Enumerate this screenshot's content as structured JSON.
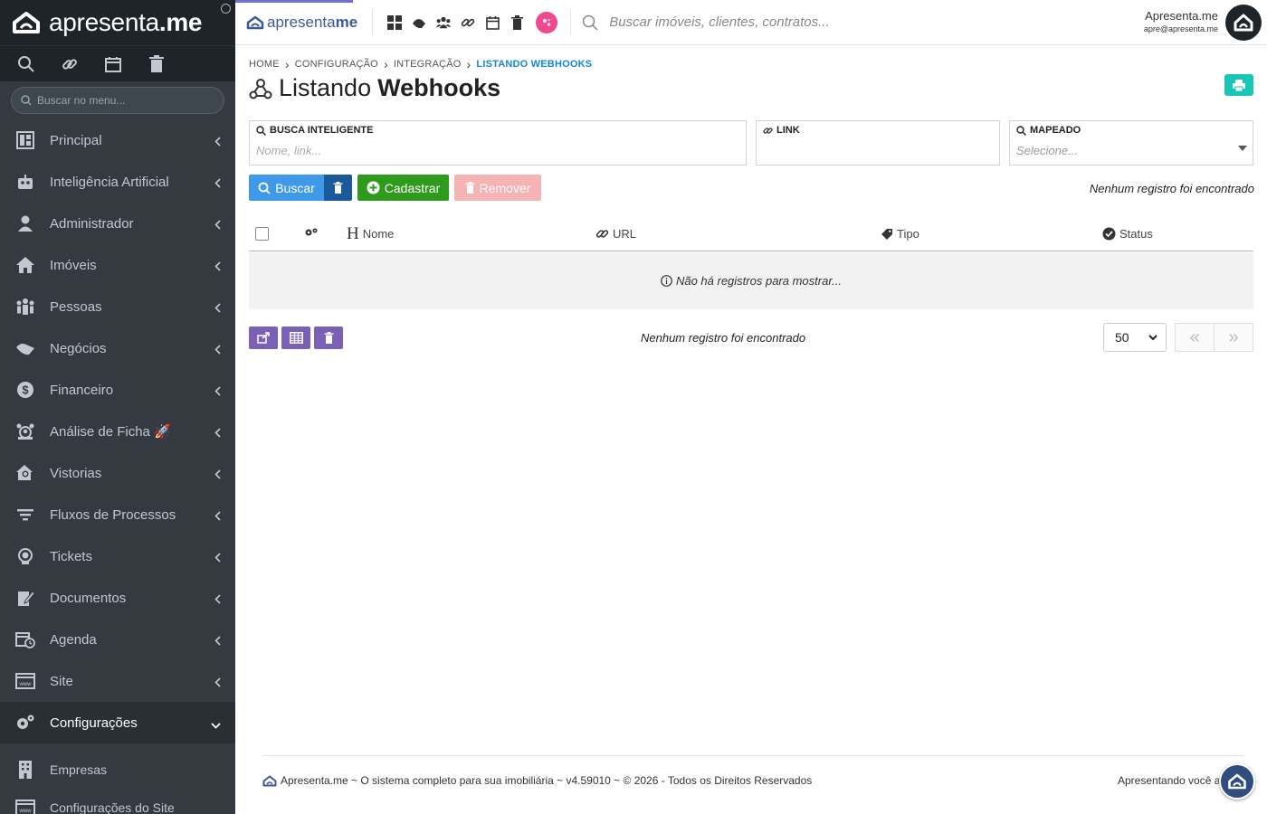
{
  "app": {
    "logo_prefix": "apresenta",
    "logo_suffix": ".me",
    "brand_small_prefix": "apresenta",
    "brand_small_suffix": "me"
  },
  "sidebar": {
    "search_placeholder": "Buscar no menu...",
    "items": [
      {
        "label": "Principal",
        "icon": "dashboard-icon"
      },
      {
        "label": "Inteligência Artificial",
        "icon": "robot-icon"
      },
      {
        "label": "Administrador",
        "icon": "user-tie-icon"
      },
      {
        "label": "Imóveis",
        "icon": "home-icon"
      },
      {
        "label": "Pessoas",
        "icon": "people-icon"
      },
      {
        "label": "Negócios",
        "icon": "handshake-icon"
      },
      {
        "label": "Financeiro",
        "icon": "dollar-icon"
      },
      {
        "label": "Análise de Ficha 🚀",
        "icon": "analysis-icon"
      },
      {
        "label": "Vistorias",
        "icon": "house-search-icon"
      },
      {
        "label": "Fluxos de Processos",
        "icon": "filter-icon"
      },
      {
        "label": "Tickets",
        "icon": "support-icon"
      },
      {
        "label": "Documentos",
        "icon": "document-edit-icon"
      },
      {
        "label": "Agenda",
        "icon": "calendar-clock-icon"
      },
      {
        "label": "Site",
        "icon": "site-icon"
      },
      {
        "label": "Configurações",
        "icon": "gears-icon"
      }
    ],
    "sub_items": [
      {
        "label": "Empresas",
        "icon": "building-icon"
      },
      {
        "label": "Configurações do Site",
        "icon": "site-config-icon"
      }
    ]
  },
  "topbar": {
    "search_placeholder": "Buscar imóveis, clientes, contratos...",
    "user_name": "Apresenta.me",
    "user_email": "apre@apresenta.me"
  },
  "breadcrumb": {
    "home": "HOME",
    "config": "CONFIGURAÇÃO",
    "integration": "INTEGRAÇÃO",
    "current": "LISTANDO WEBHOOKS"
  },
  "page": {
    "title_light": "Listando",
    "title_bold": "Webhooks"
  },
  "filters": {
    "smart_search_label": "BUSCA INTELIGENTE",
    "smart_search_placeholder": "Nome, link...",
    "link_label": "LINK",
    "link_value": "",
    "mapped_label": "MAPEADO",
    "mapped_value": "Selecione..."
  },
  "actions": {
    "search": "Buscar",
    "create": "Cadastrar",
    "remove": "Remover",
    "no_records_top": "Nenhum registro foi encontrado"
  },
  "table": {
    "columns": {
      "name": "Nome",
      "url": "URL",
      "type": "Tipo",
      "status": "Status"
    },
    "empty_message": "Não há registros para mostrar..."
  },
  "pagination": {
    "no_records": "Nenhum registro foi encontrado",
    "per_page": "50",
    "prev": "«",
    "next": "»"
  },
  "footer": {
    "left": "Apresenta.me ~ O sistema completo para sua imobiliária ~ v4.59010 ~ © 2026 - Todos os Direitos Reservados",
    "right": "Apresentando você ao mundo"
  },
  "colors": {
    "sidebar_bg": "#343a40",
    "accent_blue": "#3e9ae8",
    "dark_blue": "#1a5a9a",
    "green": "#2e9b1c",
    "red_light": "#f5b3b3",
    "purple": "#7b61b5",
    "teal": "#17c6b5",
    "pink": "#ef4a8f"
  }
}
